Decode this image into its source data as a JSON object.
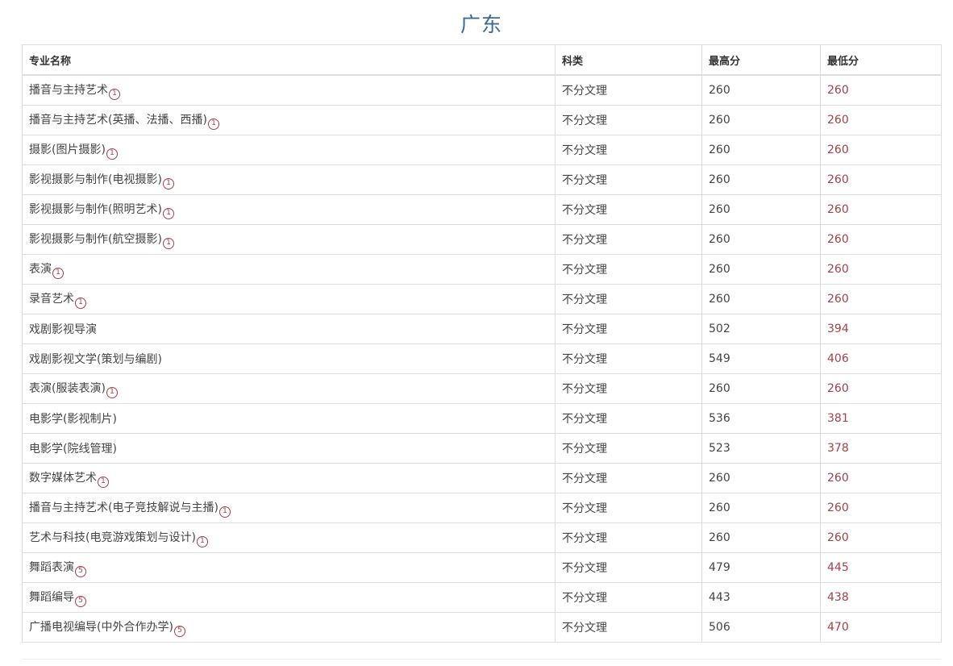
{
  "page": {
    "title": "广东"
  },
  "table": {
    "headers": [
      "专业名称",
      "科类",
      "最高分",
      "最低分"
    ],
    "rows": [
      {
        "name": "播音与主持艺术",
        "mark": "1",
        "category": "不分文理",
        "max": "260",
        "min": "260"
      },
      {
        "name": "播音与主持艺术(英播、法播、西播)",
        "mark": "1",
        "category": "不分文理",
        "max": "260",
        "min": "260"
      },
      {
        "name": "摄影(图片摄影)",
        "mark": "1",
        "category": "不分文理",
        "max": "260",
        "min": "260"
      },
      {
        "name": "影视摄影与制作(电视摄影)",
        "mark": "1",
        "category": "不分文理",
        "max": "260",
        "min": "260"
      },
      {
        "name": "影视摄影与制作(照明艺术)",
        "mark": "1",
        "category": "不分文理",
        "max": "260",
        "min": "260"
      },
      {
        "name": "影视摄影与制作(航空摄影)",
        "mark": "1",
        "category": "不分文理",
        "max": "260",
        "min": "260"
      },
      {
        "name": "表演",
        "mark": "1",
        "category": "不分文理",
        "max": "260",
        "min": "260"
      },
      {
        "name": "录音艺术",
        "mark": "1",
        "category": "不分文理",
        "max": "260",
        "min": "260"
      },
      {
        "name": "戏剧影视导演",
        "mark": "",
        "category": "不分文理",
        "max": "502",
        "min": "394"
      },
      {
        "name": "戏剧影视文学(策划与编剧)",
        "mark": "",
        "category": "不分文理",
        "max": "549",
        "min": "406"
      },
      {
        "name": "表演(服装表演)",
        "mark": "1",
        "category": "不分文理",
        "max": "260",
        "min": "260"
      },
      {
        "name": "电影学(影视制片)",
        "mark": "",
        "category": "不分文理",
        "max": "536",
        "min": "381"
      },
      {
        "name": "电影学(院线管理)",
        "mark": "",
        "category": "不分文理",
        "max": "523",
        "min": "378"
      },
      {
        "name": "数字媒体艺术",
        "mark": "1",
        "category": "不分文理",
        "max": "260",
        "min": "260"
      },
      {
        "name": "播音与主持艺术(电子竞技解说与主播)",
        "mark": "1",
        "category": "不分文理",
        "max": "260",
        "min": "260"
      },
      {
        "name": "艺术与科技(电竞游戏策划与设计)",
        "mark": "1",
        "category": "不分文理",
        "max": "260",
        "min": "260"
      },
      {
        "name": "舞蹈表演",
        "mark": "5",
        "category": "不分文理",
        "max": "479",
        "min": "445"
      },
      {
        "name": "舞蹈编导",
        "mark": "5",
        "category": "不分文理",
        "max": "443",
        "min": "438"
      },
      {
        "name": "广播电视编导(中外合作办学)",
        "mark": "5",
        "category": "不分文理",
        "max": "506",
        "min": "470"
      }
    ]
  },
  "colors": {
    "title": "#3b6b94",
    "min_score": "#a0424a",
    "border": "#dddddd"
  }
}
